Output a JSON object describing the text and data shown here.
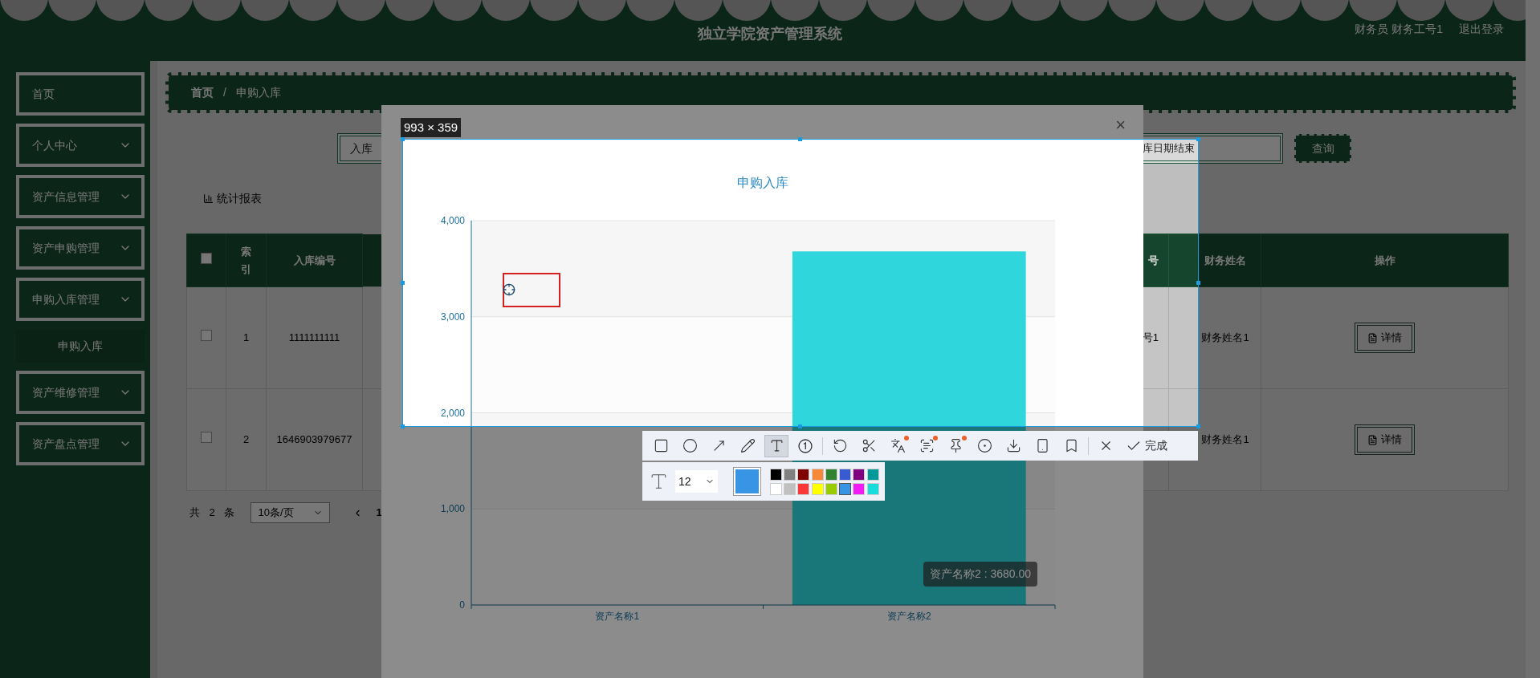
{
  "header": {
    "title": "独立学院资产管理系统",
    "role": "财务员",
    "user": "财务工号1",
    "logout": "退出登录"
  },
  "sidebar": [
    {
      "label": "首页",
      "kind": "link"
    },
    {
      "label": "个人中心",
      "kind": "menu"
    },
    {
      "label": "资产信息管理",
      "kind": "menu"
    },
    {
      "label": "资产申购管理",
      "kind": "menu"
    },
    {
      "label": "申购入库管理",
      "kind": "menu",
      "children": [
        {
          "label": "申购入库",
          "selected": true
        }
      ]
    },
    {
      "label": "资产维修管理",
      "kind": "menu"
    },
    {
      "label": "资产盘点管理",
      "kind": "menu"
    }
  ],
  "breadcrumb": {
    "separator": "/",
    "items": [
      {
        "label": "首页"
      },
      {
        "label": "申购入库"
      }
    ]
  },
  "search": {
    "fields": [
      {
        "placeholder": "入库"
      },
      {
        "placeholder": "库日期结束"
      }
    ],
    "button": "查询"
  },
  "report_button": "统计报表",
  "table": {
    "all_checked": false,
    "columns": [
      {
        "kind": "checkbox"
      },
      {
        "kind": "text",
        "label": "索引"
      },
      {
        "kind": "text",
        "label": "入库编号"
      },
      {
        "kind": "text",
        "label": "号"
      },
      {
        "kind": "text",
        "label": "财务姓名"
      },
      {
        "kind": "text",
        "label": "操作"
      }
    ],
    "rows": [
      {
        "checked": false,
        "index": "1",
        "code": "1111111111",
        "column_4": "号1",
        "finance_name": "财务姓名1",
        "action": "详情"
      },
      {
        "checked": false,
        "index": "2",
        "code": "1646903979677",
        "finance_name": "财务姓名1",
        "action": "详情"
      }
    ]
  },
  "pagination": {
    "total": "共 2 条",
    "page_size": "10条/页",
    "page": "1"
  },
  "modal": {
    "close": "×",
    "tooltip": "资产名称2 : 3680.00",
    "chart_data": {
      "type": "bar",
      "title": "申购入库",
      "grid": true,
      "categories": [
        "资产名称1",
        "资产名称2"
      ],
      "series": [
        {
          "color": "#2fd7dc",
          "values": [
            0,
            3680
          ]
        }
      ],
      "ylim": [
        0,
        4000
      ],
      "yticks": [
        0,
        {
          "value": 1000,
          "label": "1,000"
        },
        {
          "value": 2000,
          "label": "2,000"
        },
        {
          "value": 3000,
          "label": "3,000"
        },
        {
          "value": 4000,
          "label": "4,000"
        }
      ]
    }
  },
  "capture": {
    "size": "993 × 359",
    "done": "完成",
    "font_size": "12",
    "tools": [
      {
        "selected": false
      },
      {
        "selected": false
      },
      {
        "selected": false
      },
      {
        "selected": false
      },
      {
        "selected": true
      },
      {
        "selected": false
      },
      {
        "selected": false
      },
      {
        "selected": false
      },
      {
        "selected": false
      },
      {
        "selected": false
      },
      {
        "selected": false
      },
      {
        "selected": false
      },
      {
        "selected": false
      },
      {
        "selected": false
      },
      {
        "selected": false
      },
      {
        "selected": false
      }
    ],
    "palette": [
      {
        "color": "#000000",
        "selected": false
      },
      {
        "color": "#808080",
        "selected": false
      },
      {
        "color": "#800000",
        "selected": false
      },
      {
        "color": "#f7883a",
        "selected": false
      },
      {
        "color": "#308430",
        "selected": false
      },
      {
        "color": "#385ad3",
        "selected": false
      },
      {
        "color": "#800080",
        "selected": false
      },
      {
        "color": "#009999",
        "selected": false
      },
      {
        "color": "#ffffff",
        "selected": false
      },
      {
        "color": "#c0c0c0",
        "selected": false
      },
      {
        "color": "#fb3838",
        "selected": false
      },
      {
        "color": "#ffff00",
        "selected": false
      },
      {
        "color": "#99cc00",
        "selected": false
      },
      {
        "color": "#3894e4",
        "selected": true
      },
      {
        "color": "#f31bf3",
        "selected": false
      },
      {
        "color": "#16dcdc",
        "selected": false
      }
    ]
  }
}
